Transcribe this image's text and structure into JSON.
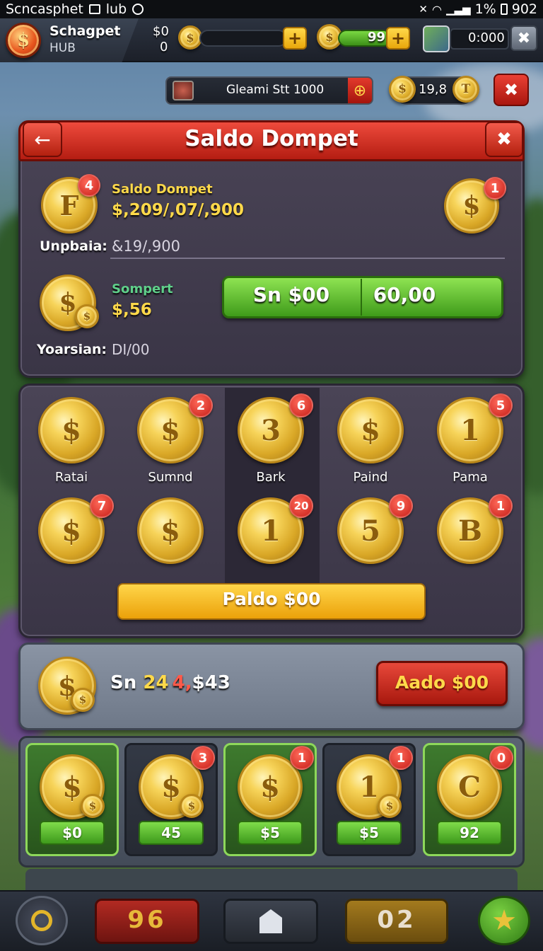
{
  "status_bar": {
    "app_name": "Scncasphet",
    "label_2": "lub",
    "battery": "1%",
    "time": "902"
  },
  "hud": {
    "hub_title": "Schagpet",
    "hub_subtitle": "HUB",
    "balance_line_1": "$0",
    "balance_line_2": "0",
    "meter_value": "99",
    "timer": "0:000",
    "plus_glyph": "+"
  },
  "topbar2": {
    "search_text": "Gleami Stt 1000",
    "coins": "19,8"
  },
  "wallet_panel": {
    "title": "Saldo Dompet",
    "main_coin_glyph": "F",
    "main_coin_badge": "4",
    "main_label": "Saldo Dompet",
    "main_amount": "$,209/,07/,900",
    "right_coin_badge": "1",
    "unpaid_label": "Unpbaia:",
    "unpaid_value": "&19/,900",
    "sub_label": "Sompert",
    "sub_amount": "$,56",
    "green_left": "Sn $00",
    "green_right": "60,00",
    "footer_label": "Yoarsian:",
    "footer_value": "DI/00"
  },
  "coin_grid": {
    "row1": [
      {
        "glyph": "$",
        "label": "Ratai",
        "badge": ""
      },
      {
        "glyph": "$",
        "label": "Sumnd",
        "badge": "2"
      },
      {
        "glyph": "3",
        "label": "Bark",
        "badge": "6"
      },
      {
        "glyph": "$",
        "label": "Paind",
        "badge": ""
      },
      {
        "glyph": "1",
        "label": "Pama",
        "badge": "5"
      }
    ],
    "row2": [
      {
        "glyph": "$",
        "badge": "7"
      },
      {
        "glyph": "$",
        "badge": ""
      },
      {
        "glyph": "1",
        "badge": "20"
      },
      {
        "glyph": "5",
        "badge": "9"
      },
      {
        "glyph": "B",
        "badge": "1"
      }
    ],
    "action_button": "Paldo $00"
  },
  "summary": {
    "prefix": "Sn",
    "highlight": "24",
    "mark": "4,",
    "amount": "$43",
    "button": "Aado $00"
  },
  "shop": [
    {
      "glyph": "$",
      "price": "$0",
      "badge": "",
      "active": true
    },
    {
      "glyph": "$",
      "price": "45",
      "badge": "3",
      "active": false
    },
    {
      "glyph": "$",
      "price": "$5",
      "badge": "1",
      "active": true
    },
    {
      "glyph": "1",
      "price": "$5",
      "badge": "1",
      "active": false
    },
    {
      "glyph": "C",
      "price": "92",
      "badge": "0",
      "active": true
    }
  ],
  "bottom_nav": {
    "red_value": "96",
    "gold_value": "02"
  }
}
